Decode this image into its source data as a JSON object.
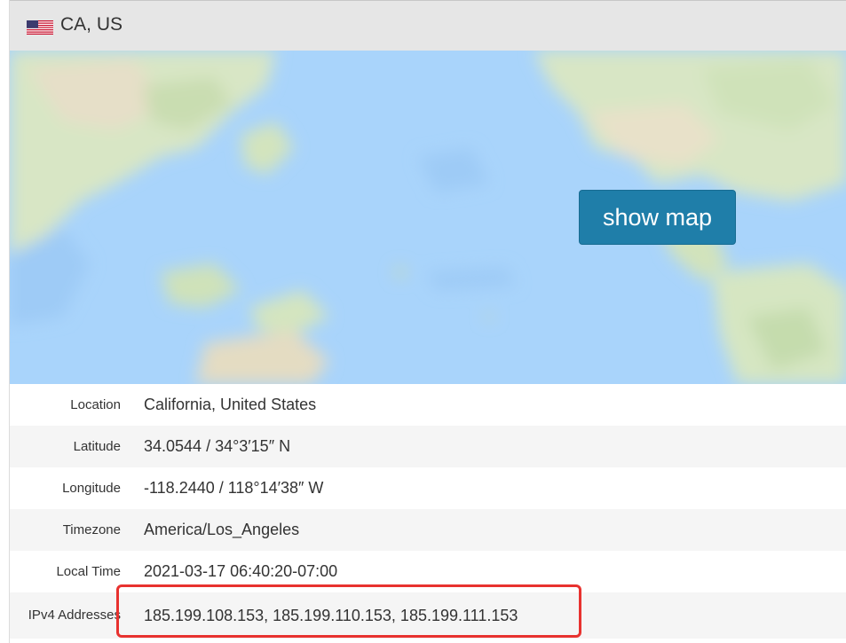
{
  "header": {
    "flag_icon": "us-flag-icon",
    "title": "CA, US"
  },
  "map": {
    "button_label": "show map",
    "button_color": "#1f7ea9",
    "water_color": "#a9d4fb",
    "land_color": "#d9e9c4"
  },
  "details": [
    {
      "label": "Location",
      "value": "California, United States"
    },
    {
      "label": "Latitude",
      "value": "34.0544 / 34°3′15″ N"
    },
    {
      "label": "Longitude",
      "value": "-118.2440 / 118°14′38″ W"
    },
    {
      "label": "Timezone",
      "value": "America/Los_Angeles"
    },
    {
      "label": "Local Time",
      "value": "2021-03-17 06:40:20-07:00"
    },
    {
      "label": "IPv4 Addresses",
      "value": "185.199.108.153, 185.199.110.153, 185.199.111.153"
    }
  ],
  "annotation": {
    "highlight_color": "#e8322f"
  }
}
